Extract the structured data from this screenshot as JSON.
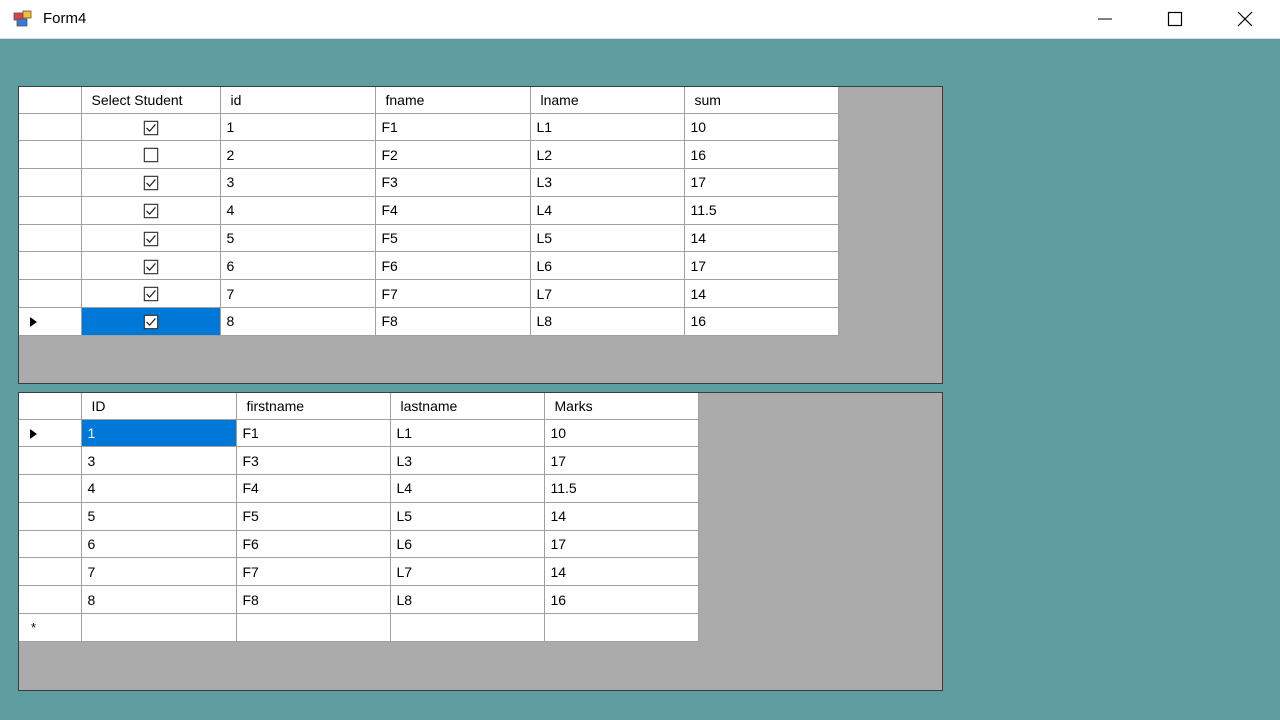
{
  "window": {
    "title": "Form4"
  },
  "grid1": {
    "headers": [
      "Select Student",
      "id",
      "fname",
      "lname",
      "sum"
    ],
    "rows": [
      {
        "checked": true,
        "id": "1",
        "fname": "F1",
        "lname": "L1",
        "sum": "10"
      },
      {
        "checked": false,
        "id": "2",
        "fname": "F2",
        "lname": "L2",
        "sum": "16"
      },
      {
        "checked": true,
        "id": "3",
        "fname": "F3",
        "lname": "L3",
        "sum": "17"
      },
      {
        "checked": true,
        "id": "4",
        "fname": "F4",
        "lname": "L4",
        "sum": "11.5"
      },
      {
        "checked": true,
        "id": "5",
        "fname": "F5",
        "lname": "L5",
        "sum": "14"
      },
      {
        "checked": true,
        "id": "6",
        "fname": "F6",
        "lname": "L6",
        "sum": "17"
      },
      {
        "checked": true,
        "id": "7",
        "fname": "F7",
        "lname": "L7",
        "sum": "14"
      },
      {
        "checked": true,
        "id": "8",
        "fname": "F8",
        "lname": "L8",
        "sum": "16"
      }
    ]
  },
  "grid2": {
    "headers": [
      "ID",
      "firstname",
      "lastname",
      "Marks"
    ],
    "rows": [
      {
        "id": "1",
        "firstname": "F1",
        "lastname": "L1",
        "marks": "10"
      },
      {
        "id": "3",
        "firstname": "F3",
        "lastname": "L3",
        "marks": "17"
      },
      {
        "id": "4",
        "firstname": "F4",
        "lastname": "L4",
        "marks": "11.5"
      },
      {
        "id": "5",
        "firstname": "F5",
        "lastname": "L5",
        "marks": "14"
      },
      {
        "id": "6",
        "firstname": "F6",
        "lastname": "L6",
        "marks": "17"
      },
      {
        "id": "7",
        "firstname": "F7",
        "lastname": "L7",
        "marks": "14"
      },
      {
        "id": "8",
        "firstname": "F8",
        "lastname": "L8",
        "marks": "16"
      }
    ],
    "new_row_marker": "*"
  },
  "colors": {
    "form_bg": "#5f9ea0",
    "grid_bg": "#ababab",
    "selection": "#0078d7"
  },
  "icons": [
    "form-app-icon",
    "minimize-icon",
    "maximize-icon",
    "close-icon",
    "row-pointer-icon",
    "checkbox-icon"
  ]
}
